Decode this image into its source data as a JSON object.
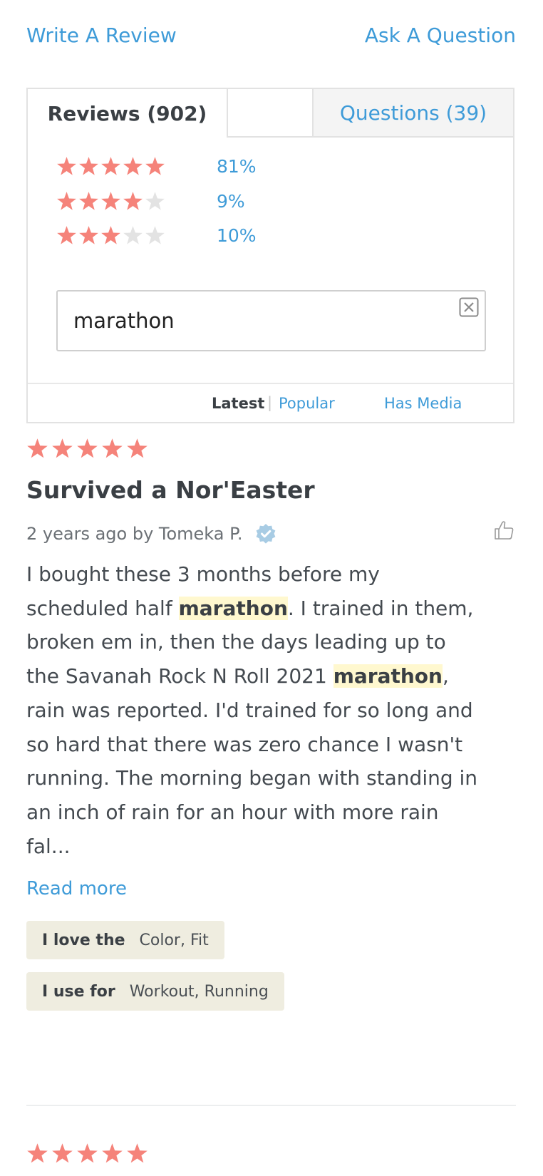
{
  "top_links": {
    "write_review": "Write A Review",
    "ask_question": "Ask A Question"
  },
  "tabs": {
    "reviews": "Reviews (902)",
    "questions": "Questions (39)"
  },
  "rating_breakdown": [
    {
      "stars": 5,
      "percent_label": "81%"
    },
    {
      "stars": 4,
      "percent_label": "9%"
    },
    {
      "stars": 3,
      "percent_label": "10%"
    }
  ],
  "search": {
    "value": "marathon"
  },
  "sort": {
    "latest": "Latest",
    "separator": "|",
    "popular": "Popular",
    "has_media": "Has Media"
  },
  "review": {
    "rating": 5,
    "title": "Survived a Nor'Easter",
    "meta": "2 years ago by Tomeka P.",
    "body_lines": [
      [
        "I bought these 3 months before my"
      ],
      [
        "scheduled half ",
        "marathon",
        ". I trained in them,"
      ],
      [
        "broken em in, then the days leading up to"
      ],
      [
        "the Savanah Rock N Roll 2021 ",
        "marathon",
        ","
      ],
      [
        "rain was reported. I'd trained for so long and"
      ],
      [
        "so hard that there was zero chance I wasn't"
      ],
      [
        "running. The morning began with standing in"
      ],
      [
        "an inch of rain for an hour with more rain"
      ],
      [
        "fal..."
      ]
    ],
    "read_more": "Read more",
    "tags": [
      {
        "label": "I love the",
        "value": "Color, Fit"
      },
      {
        "label": "I use for",
        "value": "Workout, Running"
      }
    ]
  },
  "next_review": {
    "rating": 5
  },
  "colors": {
    "star_filled": "#f5837a",
    "star_empty": "#e3e3e3",
    "link": "#3e9bd8",
    "highlight": "#fff8cf",
    "tag_bg": "#efede0"
  }
}
